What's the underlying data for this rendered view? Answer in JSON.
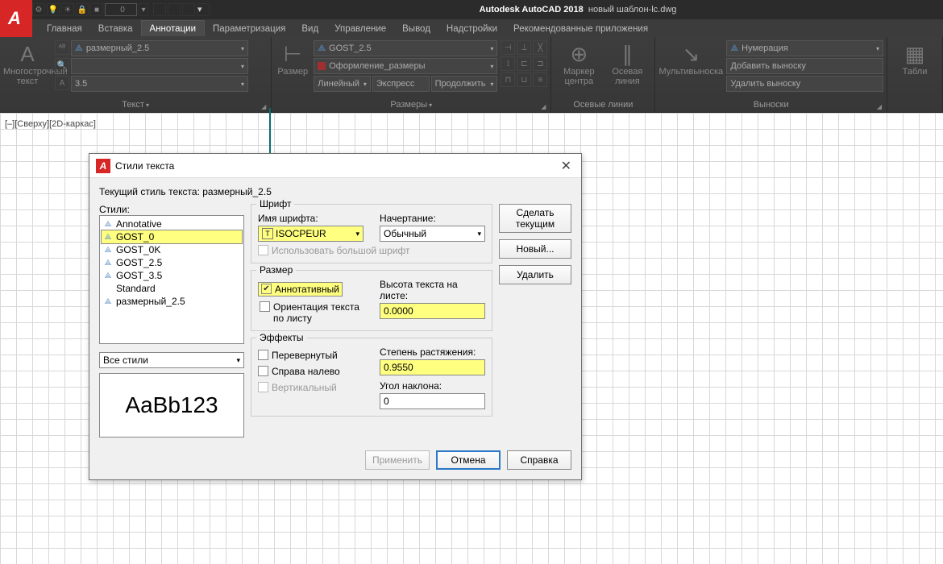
{
  "title": {
    "app": "Autodesk AutoCAD 2018",
    "file": "новый шаблон-lc.dwg"
  },
  "qat_layer": "0",
  "tabs": [
    "Главная",
    "Вставка",
    "Аннотации",
    "Параметризация",
    "Вид",
    "Управление",
    "Вывод",
    "Надстройки",
    "Рекомендованные приложения"
  ],
  "active_tab": "Аннотации",
  "ribbon": {
    "text": {
      "big_label": "Многострочный\nтекст",
      "combo1": "размерный_2.5",
      "combo2": "3.5",
      "panel_label": "Текст"
    },
    "dims": {
      "big_label": "Размер",
      "combo1": "GOST_2.5",
      "combo2": "Оформление_размеры",
      "btn1": "Линейный",
      "btn2": "Экспресс",
      "btn3": "Продолжить",
      "panel_label": "Размеры"
    },
    "axes": {
      "btn1": "Маркер центра",
      "btn2": "Осевая линия",
      "panel_label": "Осевые линии"
    },
    "leaders": {
      "big_label": "Мультивыноска",
      "combo": "Нумерация",
      "btn1": "Добавить выноску",
      "btn2": "Удалить выноску",
      "panel_label": "Выноски"
    },
    "tables": {
      "big_label": "Табли"
    }
  },
  "view_label": "[–][Сверху][2D-каркас]",
  "dialog": {
    "title": "Стили текста",
    "current": "Текущий стиль текста:  размерный_2.5",
    "styles_label": "Стили:",
    "styles": [
      "Annotative",
      "GOST_0",
      "GOST_0K",
      "GOST_2.5",
      "GOST_3.5",
      "Standard",
      "размерный_2.5"
    ],
    "selected_style": "GOST_0",
    "filter": "Все стили",
    "preview": "AaBb123",
    "font": {
      "legend": "Шрифт",
      "name_label": "Имя шрифта:",
      "name_value": "ISOCPEUR",
      "style_label": "Начертание:",
      "style_value": "Обычный",
      "bigfont": "Использовать большой шрифт"
    },
    "size": {
      "legend": "Размер",
      "annotative": "Аннотативный",
      "match_orient": "Ориентация текста по листу",
      "height_label": "Высота текста на листе:",
      "height_value": "0.0000"
    },
    "effects": {
      "legend": "Эффекты",
      "upside": "Перевернутый",
      "backwards": "Справа налево",
      "vertical": "Вертикальный",
      "width_label": "Степень растяжения:",
      "width_value": "0.9550",
      "oblique_label": "Угол наклона:",
      "oblique_value": "0"
    },
    "buttons": {
      "set_current": "Сделать текущим",
      "new": "Новый...",
      "delete": "Удалить",
      "apply": "Применить",
      "cancel": "Отмена",
      "help": "Справка"
    }
  }
}
